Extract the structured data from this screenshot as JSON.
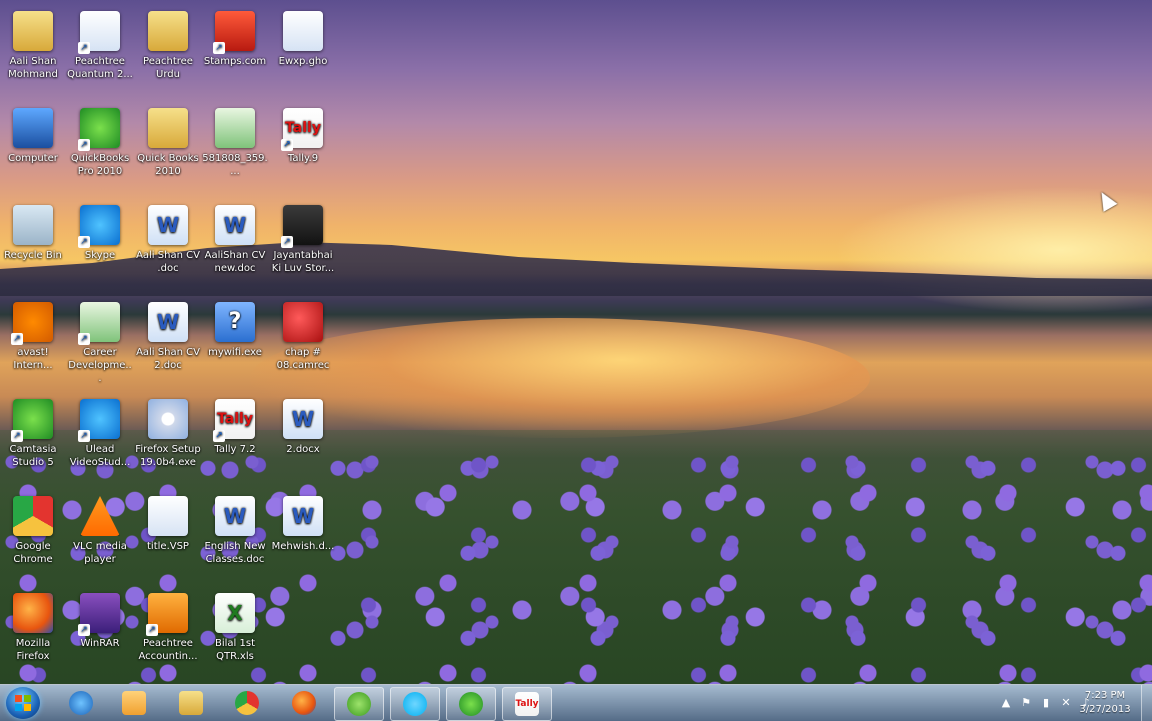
{
  "desktop": {
    "icons": [
      {
        "label": "Aali Shan Mohmand",
        "icon": "folder-user-icon"
      },
      {
        "label": "Peachtree Quantum 2...",
        "icon": "app-shortcut-icon"
      },
      {
        "label": "Peachtree Urdu",
        "icon": "folder-icon"
      },
      {
        "label": "Stamps.com",
        "icon": "stamps-icon"
      },
      {
        "label": "Ewxp.gho",
        "icon": "file-icon"
      },
      {
        "label": "Computer",
        "icon": "computer-icon"
      },
      {
        "label": "QuickBooks Pro 2010",
        "icon": "quickbooks-icon"
      },
      {
        "label": "Quick Books 2010",
        "icon": "folder-icon"
      },
      {
        "label": "581808_359....",
        "icon": "image-file-icon"
      },
      {
        "label": "Tally.9",
        "icon": "tally-icon"
      },
      {
        "label": "Recycle Bin",
        "icon": "recycle-bin-icon"
      },
      {
        "label": "Skype",
        "icon": "skype-icon"
      },
      {
        "label": "Aali Shan CV .doc",
        "icon": "word-doc-icon"
      },
      {
        "label": "AaliShan CV new.doc",
        "icon": "word-doc-icon"
      },
      {
        "label": "Jayantabhai Ki Luv Stor...",
        "icon": "video-file-icon"
      },
      {
        "label": "avast! Intern...",
        "icon": "avast-icon"
      },
      {
        "label": "Career Developme...",
        "icon": "career-icon"
      },
      {
        "label": "Aali Shan CV 2.doc",
        "icon": "word-doc-icon"
      },
      {
        "label": "mywifi.exe",
        "icon": "help-exe-icon"
      },
      {
        "label": "chap # 08.camrec",
        "icon": "camrec-icon"
      },
      {
        "label": "Camtasia Studio 5",
        "icon": "camtasia-icon"
      },
      {
        "label": "Ulead VideoStud...",
        "icon": "ulead-icon"
      },
      {
        "label": "Firefox Setup 19.0b4.exe",
        "icon": "setup-cd-icon"
      },
      {
        "label": "Tally 7.2",
        "icon": "tally-icon"
      },
      {
        "label": "2.docx",
        "icon": "word-doc-icon"
      },
      {
        "label": "Google Chrome",
        "icon": "chrome-icon"
      },
      {
        "label": "VLC media player",
        "icon": "vlc-icon"
      },
      {
        "label": "title.VSP",
        "icon": "vsp-file-icon"
      },
      {
        "label": "English New Classes.doc",
        "icon": "word-doc-icon"
      },
      {
        "label": "Mehwish.d...",
        "icon": "word-doc-icon"
      },
      {
        "label": "Mozilla Firefox",
        "icon": "firefox-icon"
      },
      {
        "label": "WinRAR",
        "icon": "winrar-icon"
      },
      {
        "label": "Peachtree Accountin...",
        "icon": "peachtree-icon"
      },
      {
        "label": "Bilal 1st QTR.xls",
        "icon": "excel-icon"
      }
    ]
  },
  "taskbar": {
    "start_label": "Start",
    "pinned": [
      {
        "name": "internet-explorer",
        "icon": "ie-icon",
        "color": "#2b8be0"
      },
      {
        "name": "media-player",
        "icon": "media-player-icon",
        "color": "#f0a030"
      },
      {
        "name": "explorer",
        "icon": "folder-icon",
        "color": "#e9c35a"
      },
      {
        "name": "chrome",
        "icon": "chrome-icon",
        "color": "#e3342f"
      },
      {
        "name": "firefox",
        "icon": "firefox-icon",
        "color": "#e8550f"
      },
      {
        "name": "utorrent",
        "icon": "utorrent-icon",
        "color": "#5fbf3a"
      },
      {
        "name": "skype",
        "icon": "skype-icon",
        "color": "#00aff0"
      },
      {
        "name": "camtasia",
        "icon": "camtasia-icon",
        "color": "#2aa02a"
      },
      {
        "name": "tally",
        "icon": "tally-icon",
        "color": "#d11a1a"
      }
    ],
    "tray": [
      "up-arrow-icon",
      "flag-icon",
      "battery-icon",
      "network-icon",
      "volume-icon"
    ],
    "clock": {
      "time": "7:23 PM",
      "date": "3/27/2013"
    }
  }
}
